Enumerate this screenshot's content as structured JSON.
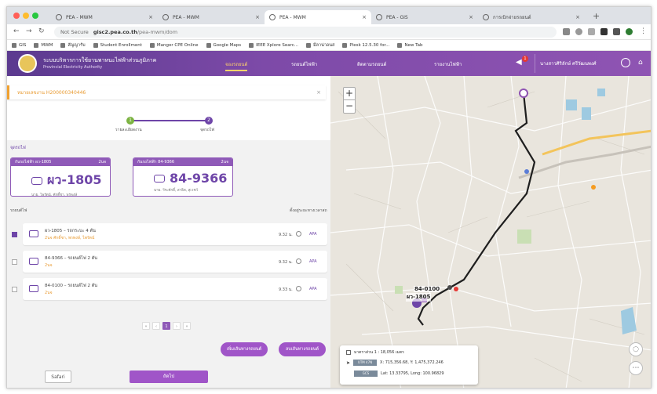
{
  "browser": {
    "tabs": [
      {
        "title": "PEA - MWM"
      },
      {
        "title": "PEA - MWM"
      },
      {
        "title": "PEA - MWM"
      },
      {
        "title": "PEA - GIS"
      },
      {
        "title": "การเบิกจ่ายรถยนต์"
      }
    ],
    "not_secure": "Not Secure",
    "url_domain": "gisc2.pea.co.th",
    "url_path": "/pea-mwm/dom",
    "bookmarks": [
      "GIS",
      "MWM",
      "สัญญารับ",
      "Student Enrollment",
      "Mangor CPE Online",
      "Google Maps",
      "IEEE Xplore Searc...",
      "มีลาน่าอนส",
      "Plesk 12.5.30 for...",
      "New Tab"
    ]
  },
  "app": {
    "title": "ระบบบริหารการใช้ยานพาหนะไฟฟ้าส่วนภูมิภาค",
    "subtitle": "Provincial Electricity Authority",
    "nav": [
      "จองรถยนต์",
      "รถยนต์ไฟฟ้า",
      "ติดตามรถยนต์",
      "รายงานไฟฟ้า"
    ],
    "nav_active_index": 0,
    "notification_count": "1",
    "user_name": "นางสาวศิริลักษ์ ศรีวัฒนพงศ์"
  },
  "request": {
    "label": "หมายเลขงาน H200000340446",
    "steps": [
      "รายละเอียดงาน",
      "จุดรถไฟ"
    ]
  },
  "selected_section": "จุดรถไฟ",
  "cards": [
    {
      "head": "กันรถไฟฟ้า ผว-1805",
      "time": "2นจ",
      "plate": "ผว-1805",
      "driver": "นาย. ไพรัตน์, ศักดิ์ชา, พรพงษ์"
    },
    {
      "head": "กันรถไฟฟ้า 84-9366",
      "time": "2นจ",
      "plate": "84-9366",
      "driver": "นาย. วีระศักดิ์, สาธิต, สุเวชว์"
    }
  ],
  "list": {
    "header_left": "รถยนต์ไฟ",
    "header_right": "ตั้งอยู่ระยะทางเวลาสถ",
    "rows": [
      {
        "title": "ผว-1805 – รถกระบะ 4 ตัน",
        "sub": "2นจ ศักดิ์ชา, พรพงษ์, ไพรัตน์",
        "time": "9.32 น.",
        "link": "APA",
        "checked": true
      },
      {
        "title": "84-9366 – รถยนต์ไฟ 2 ตัน",
        "sub": "2นจ",
        "time": "9.32 น.",
        "link": "APA",
        "checked": false
      },
      {
        "title": "84-0100 – รถยนต์ไฟ 2 ตัน",
        "sub": "2นจ",
        "time": "9.33 น.",
        "link": "APA",
        "checked": false
      }
    ]
  },
  "pager": {
    "first": "«",
    "prev": "‹",
    "current": "1",
    "next": "›",
    "last": "»"
  },
  "buttons": {
    "add_route": "เพิ่มเส้นทางรถยนต์",
    "remove_route": "ลบเส้นทางรถยนต์",
    "back": "Safari",
    "submit": "ถัดไป"
  },
  "map": {
    "zoom_in": "+",
    "zoom_out": "−",
    "marker_labels": [
      "84-0100",
      "ผว-1805"
    ],
    "scale_text": "มาตราส่วน 1 : 18,056 เมตร",
    "utm_label": "UTM 47N",
    "utm_value": "X: 715,356.68, Y: 1,475,372.246",
    "gcs_label": "GCS",
    "gcs_value": "Lat: 13.33795, Long: 100.96829"
  },
  "colors": {
    "brand_purple": "#8f54b3",
    "accent_orange": "#e89a30",
    "route": "#222222"
  }
}
